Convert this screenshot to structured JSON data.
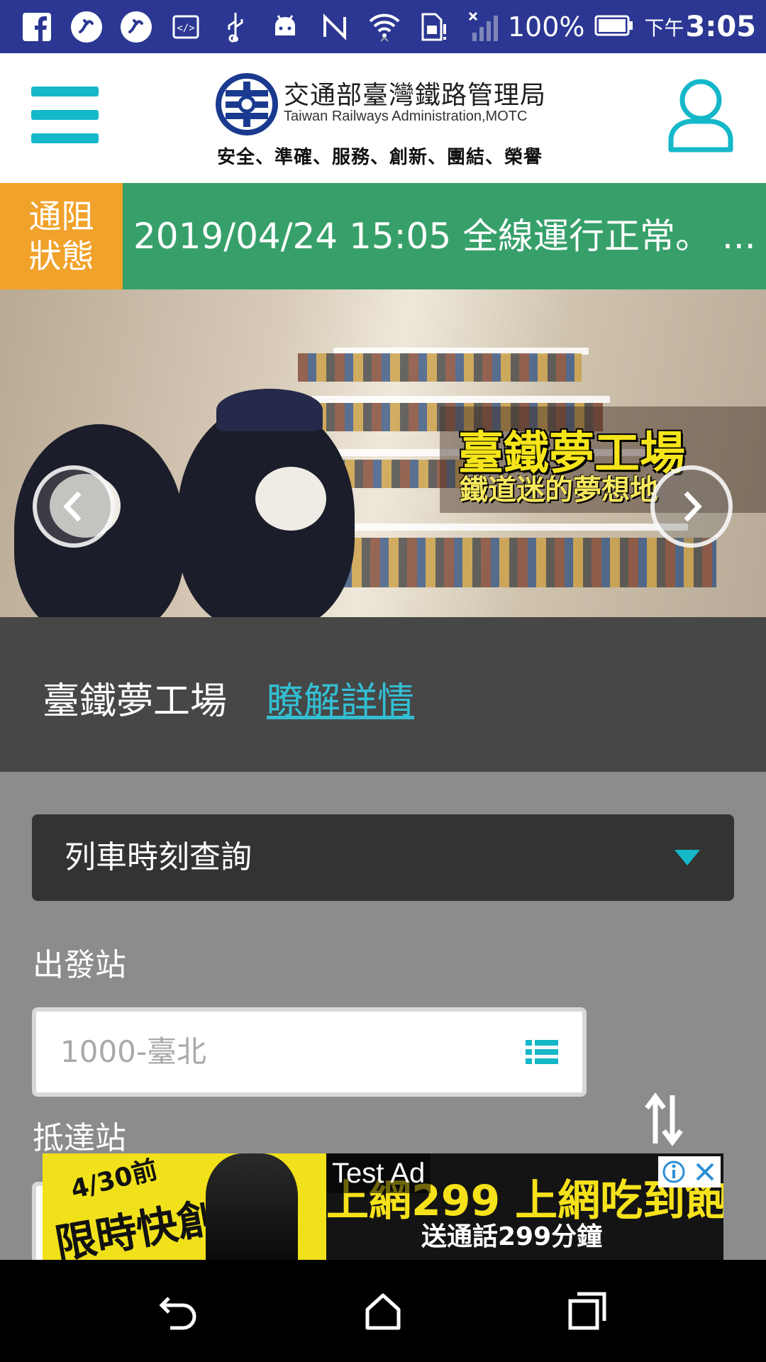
{
  "status_bar": {
    "battery": "100%",
    "time_prefix": "下午",
    "time": "3:05",
    "icons": [
      "facebook-icon",
      "app-icon",
      "app-icon",
      "code-icon",
      "usb-icon",
      "android-icon",
      "nfc-icon",
      "wifi-icon",
      "sim-icon",
      "signal-icon",
      "battery-icon"
    ]
  },
  "header": {
    "logo_title": "交通部臺灣鐵路管理局",
    "logo_subtitle": "Taiwan Railways Administration,MOTC",
    "logo_motto": "安全、準確、服務、創新、團結、榮譽"
  },
  "traffic": {
    "tag": "通阻狀態",
    "message": "2019/04/24 15:05 全線運行正常。 ..."
  },
  "banner": {
    "title": "臺鐵夢工場",
    "subtitle": "鐵道迷的夢想地"
  },
  "caption": {
    "title": "臺鐵夢工場",
    "link": "瞭解詳情"
  },
  "form": {
    "query_type": "列車時刻查詢",
    "departure_label": "出發站",
    "departure_value": "1000-臺北",
    "arrival_label": "抵達站"
  },
  "ad": {
    "label": "Test Ad",
    "promo_top": "4/30前",
    "promo_main": "限時快創",
    "headline": "上網299 上網吃到飽",
    "subline": "送通話299分鐘"
  },
  "colors": {
    "status_bar": "#2b3792",
    "accent": "#14b8c8",
    "traffic_tag": "#f1a22b",
    "traffic_bar": "#37a06a",
    "link": "#33bfd3"
  }
}
